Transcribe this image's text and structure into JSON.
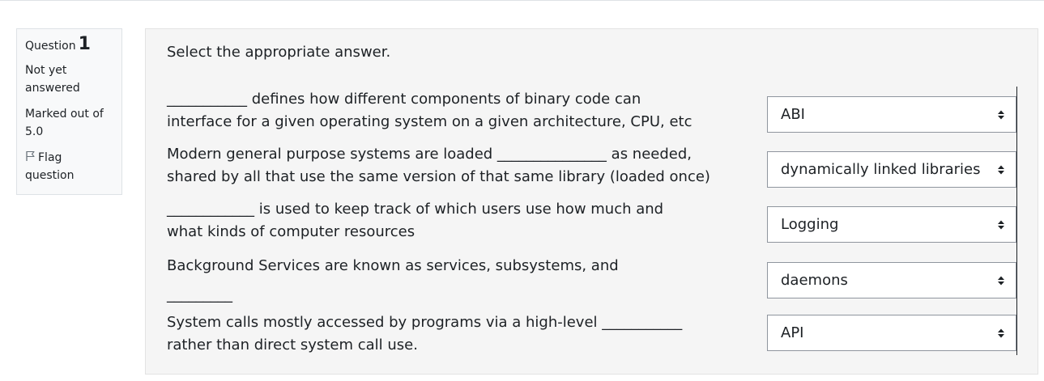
{
  "info": {
    "question_label": "Question",
    "question_number": "1",
    "state": "Not yet answered",
    "grade": "Marked out of 5.0",
    "flag_label": "Flag question"
  },
  "prompt": "Select the appropriate answer.",
  "rows": [
    {
      "line1": "___________ defines how different components of binary code can",
      "line2": "interface for a given operating system on a given architecture, CPU, etc",
      "answer": "ABI"
    },
    {
      "line1": "Modern general purpose systems are loaded  _______________ as needed,",
      "line2": "shared by all that use the same version of that same library (loaded once)",
      "answer": "dynamically linked libraries"
    },
    {
      "line1": "____________ is used to keep track of which users use how much and",
      "line2": "what kinds of computer resources",
      "answer": "Logging"
    },
    {
      "line1": "Background Services are known as services, subsystems, and",
      "line2": "_________",
      "answer": "daemons"
    },
    {
      "line1": "System calls mostly accessed by programs via a high-level ___________",
      "line2": "rather than direct system call use.",
      "answer": "API"
    }
  ]
}
